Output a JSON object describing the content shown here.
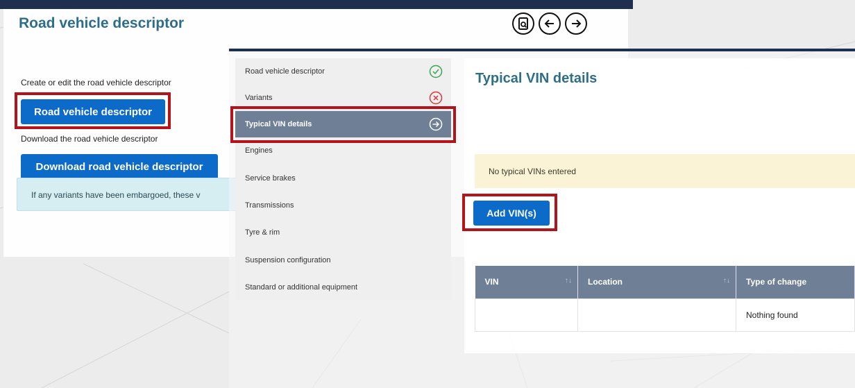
{
  "back": {
    "title": "Road vehicle descriptor",
    "toolbar": {
      "icons": [
        "document-preview-icon",
        "arrow-left-icon",
        "arrow-right-icon"
      ]
    },
    "create_text": "Create or edit the road vehicle descriptor",
    "rvd_button": "Road vehicle descriptor",
    "download_text": "Download the road vehicle descriptor",
    "download_button": "Download road vehicle descriptor",
    "info": "If any variants have been embargoed, these v"
  },
  "sidebar": {
    "items": [
      {
        "label": "Road vehicle descriptor",
        "status": "complete"
      },
      {
        "label": "Variants",
        "status": "error"
      },
      {
        "label": "Typical VIN details",
        "status": "current"
      },
      {
        "label": "Engines",
        "status": ""
      },
      {
        "label": "Service brakes",
        "status": ""
      },
      {
        "label": "Transmissions",
        "status": ""
      },
      {
        "label": "Tyre & rim",
        "status": ""
      },
      {
        "label": "Suspension configuration",
        "status": ""
      },
      {
        "label": "Standard or additional equipment",
        "status": ""
      }
    ]
  },
  "main": {
    "title": "Typical VIN details",
    "warning": "No typical VINs entered",
    "add_button": "Add VIN(s)",
    "table": {
      "headers": [
        "VIN",
        "Location",
        "Type of change"
      ],
      "empty_message": "Nothing found"
    }
  },
  "colors": {
    "accent_blue": "#0c6ac9",
    "title_teal": "#2d6e8a",
    "highlight_red": "#b3131b",
    "nav_active": "#6f7f96",
    "success_green": "#3aa655",
    "error_red": "#d9363e"
  }
}
